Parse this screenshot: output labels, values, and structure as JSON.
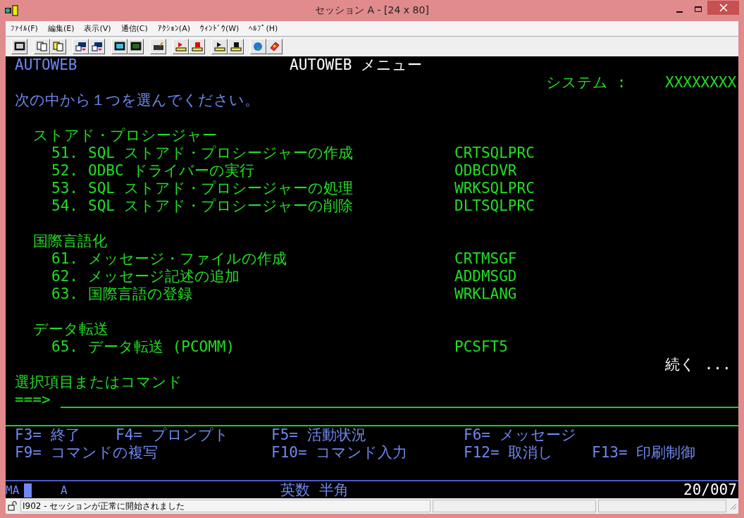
{
  "window": {
    "title": "セッション A - [24 x 80]"
  },
  "menu_bar": [
    "ﾌｧｲﾙ(F)",
    "編集(E)",
    "表示(V)",
    "通信(C)",
    "ｱｸｼｮﾝ(A)",
    "ｳｨﾝﾄﾞｳ(W)",
    "ﾍﾙﾌﾟ(H)"
  ],
  "screen": {
    "app_name": "AUTOWEB",
    "title": "AUTOWEB メニュー",
    "system_label": "システム :",
    "system_value": "XXXXXXXX",
    "instruction": "次の中から１つを選んでください。",
    "sections": [
      {
        "heading": "ストアド・プロシージャー",
        "options": [
          {
            "number": "51.",
            "label": "SQL ストアド・プロシージャーの作成",
            "command": "CRTSQLPRC"
          },
          {
            "number": "52.",
            "label": "ODBC ドライバーの実行",
            "command": "ODBCDVR"
          },
          {
            "number": "53.",
            "label": "SQL ストアド・プロシージャーの処理",
            "command": "WRKSQLPRC"
          },
          {
            "number": "54.",
            "label": "SQL ストアド・プロシージャーの削除",
            "command": "DLTSQLPRC"
          }
        ]
      },
      {
        "heading": "国際言語化",
        "options": [
          {
            "number": "61.",
            "label": "メッセージ・ファイルの作成",
            "command": "CRTMSGF"
          },
          {
            "number": "62.",
            "label": "メッセージ記述の追加",
            "command": "ADDMSGD"
          },
          {
            "number": "63.",
            "label": "国際言語の登録",
            "command": "WRKLANG"
          }
        ]
      },
      {
        "heading": "データ転送",
        "options": [
          {
            "number": "65.",
            "label": "データ転送 (PCOMM)",
            "command": "PCSFT5"
          }
        ]
      }
    ],
    "more": "続く ...",
    "prompt_label": "選択項目またはコマンド",
    "command_prompt": "===>",
    "function_keys": [
      [
        "F3= 終了",
        "F4= プロンプト",
        "F5= 活動状況",
        "F6= メッセージ"
      ],
      [
        "F9= コマンドの複写",
        "F10= コマンド入力",
        "F12= 取消し",
        "F13= 印刷制御"
      ]
    ]
  },
  "oia": {
    "mode": "MA",
    "shift": "A",
    "input_mode": "英数 半角",
    "cursor_position": "20/007"
  },
  "status_bar": {
    "message": "I902 - セッションが正常に開始されました"
  }
}
